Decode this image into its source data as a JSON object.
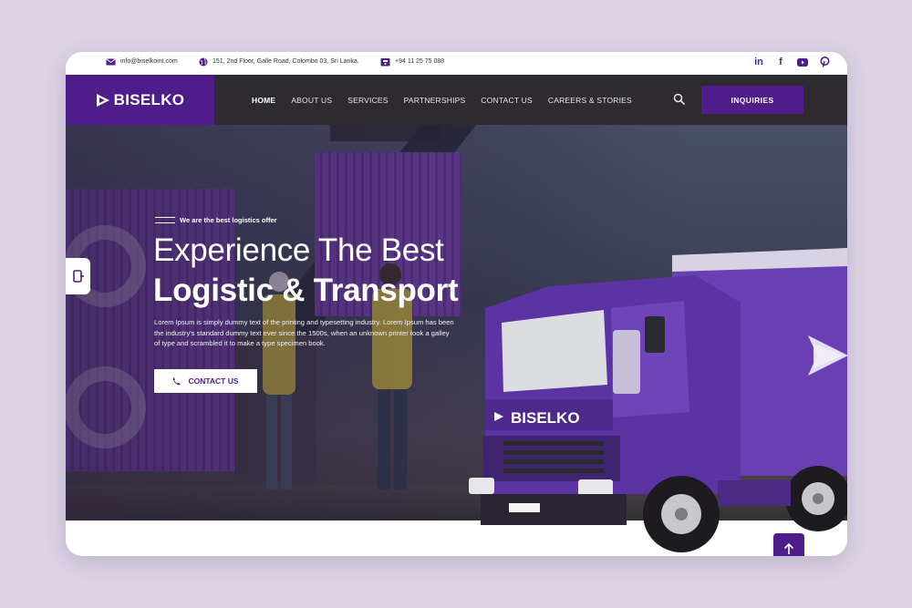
{
  "topbar": {
    "email": "info@biselkoint.com",
    "address": "151, 2nd Floor, Galle Road, Colombo 03, Sri Lanka.",
    "phone": "+94 11 25 75 088",
    "social": [
      "linkedin-icon",
      "facebook-icon",
      "youtube-icon",
      "pinterest-icon"
    ]
  },
  "brand": {
    "name": "BISELKO",
    "accent": "#4e1d8a",
    "nav_bg": "#2d2b30"
  },
  "nav": {
    "items": [
      "HOME",
      "ABOUT US",
      "SERVICES",
      "PARTNERSHIPS",
      "CONTACT US",
      "CAREERS & STORIES"
    ],
    "active": "HOME",
    "cta": "INQUIRIES"
  },
  "hero": {
    "tagline": "We are the best logistics offer",
    "title_line1": "Experience The Best",
    "title_line2": "Logistic & Transport",
    "paragraph": "Lorem Ipsum is simply dummy text of the printing and typesetting industry. Lorem Ipsum has been the industry's standard dummy text ever since the 1500s, when an unknown printer took a galley of type and scrambled it to make a type specimen book.",
    "cta": "CONTACT US",
    "truck_brand": "BISELKO"
  }
}
